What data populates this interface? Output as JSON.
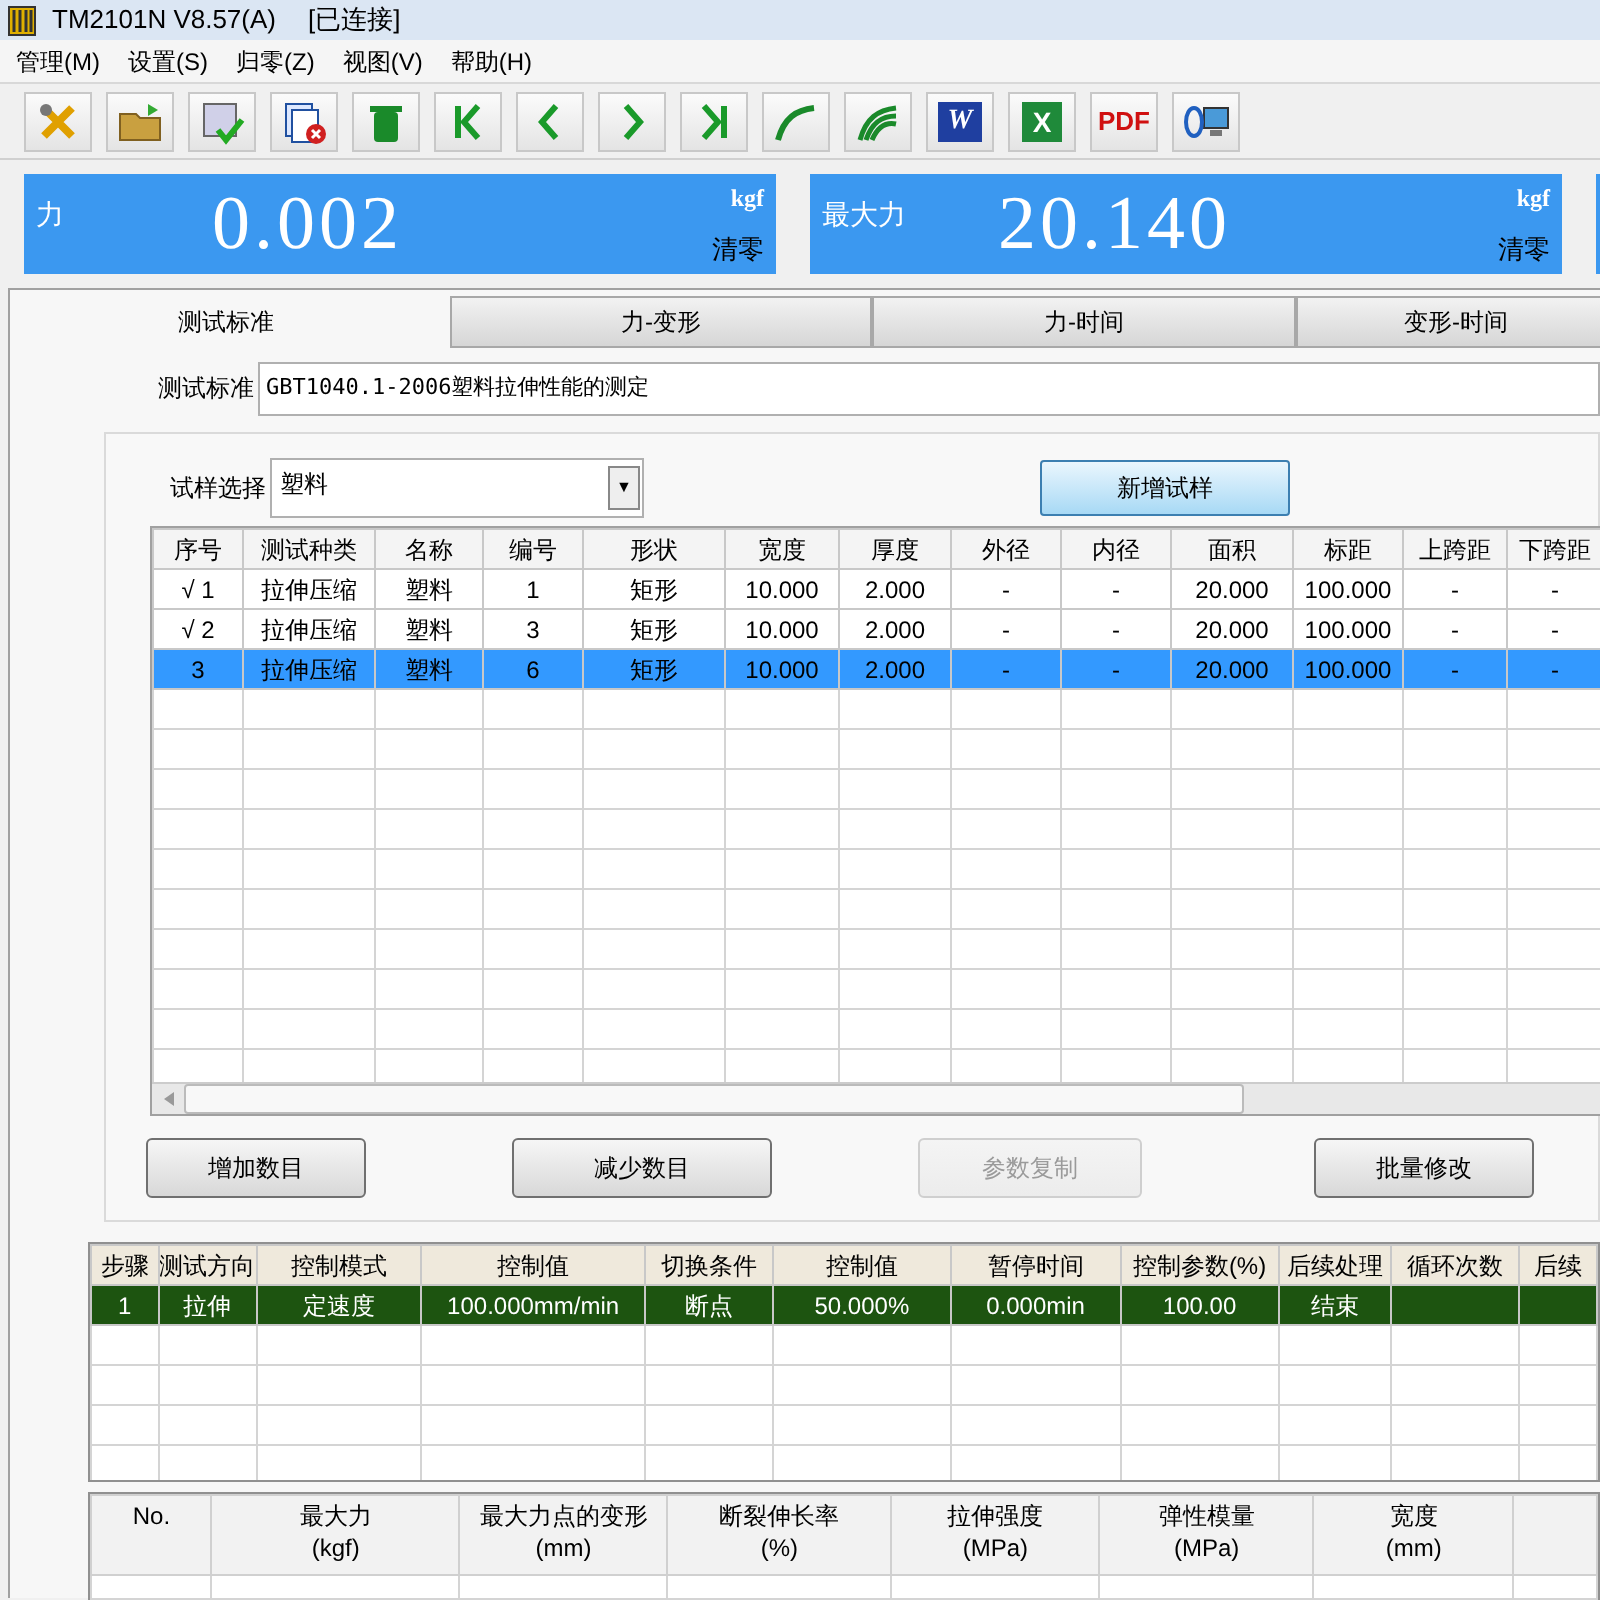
{
  "window": {
    "title": "TM2101N V8.57(A)",
    "status": "[已连接]"
  },
  "menu": [
    "管理(M)",
    "设置(S)",
    "归零(Z)",
    "视图(V)",
    "帮助(H)"
  ],
  "toolbar": [
    {
      "kind": "tools"
    },
    {
      "kind": "folder"
    },
    {
      "kind": "save"
    },
    {
      "kind": "delete-doc"
    },
    {
      "kind": "trash"
    },
    {
      "kind": "first"
    },
    {
      "kind": "prev"
    },
    {
      "kind": "next"
    },
    {
      "kind": "last"
    },
    {
      "kind": "curve"
    },
    {
      "kind": "curves"
    },
    {
      "kind": "word",
      "label": "W"
    },
    {
      "kind": "excel",
      "label": "X"
    },
    {
      "kind": "pdf",
      "label": "PDF"
    },
    {
      "kind": "connect"
    }
  ],
  "displays": [
    {
      "label": "力",
      "value": "0.002",
      "unit": "kgf",
      "zero_button": "清零"
    },
    {
      "label": "最大力",
      "value": "20.140",
      "unit": "kgf",
      "zero_button": "清零"
    }
  ],
  "tabs": [
    {
      "label": "测试标准",
      "selected": true
    },
    {
      "label": "力-变形",
      "selected": false
    },
    {
      "label": "力-时间",
      "selected": false
    },
    {
      "label": "变形-时间",
      "selected": false
    }
  ],
  "standard": {
    "label": "测试标准",
    "value": "GBT1040.1-2006塑料拉伸性能的测定"
  },
  "sample_select": {
    "label": "试样选择",
    "value": "塑料",
    "dropdown_icon": "▼"
  },
  "new_sample_button": "新增试样",
  "samples": {
    "columns": [
      "序号",
      "测试种类",
      "名称",
      "编号",
      "形状",
      "宽度",
      "厚度",
      "外径",
      "内径",
      "面积",
      "标距",
      "上跨距",
      "下跨距"
    ],
    "rows": [
      {
        "selected": false,
        "cells": [
          "√ 1",
          "拉伸压缩",
          "塑料",
          "1",
          "矩形",
          "10.000",
          "2.000",
          "-",
          "-",
          "20.000",
          "100.000",
          "-",
          "-"
        ]
      },
      {
        "selected": false,
        "cells": [
          "√ 2",
          "拉伸压缩",
          "塑料",
          "3",
          "矩形",
          "10.000",
          "2.000",
          "-",
          "-",
          "20.000",
          "100.000",
          "-",
          "-"
        ]
      },
      {
        "selected": true,
        "cells": [
          "3",
          "拉伸压缩",
          "塑料",
          "6",
          "矩形",
          "10.000",
          "2.000",
          "-",
          "-",
          "20.000",
          "100.000",
          "-",
          "-"
        ]
      }
    ]
  },
  "buttons": [
    {
      "label": "增加数目",
      "disabled": false
    },
    {
      "label": "减少数目",
      "disabled": false
    },
    {
      "label": "参数复制",
      "disabled": true
    },
    {
      "label": "批量修改",
      "disabled": false
    }
  ],
  "steps": {
    "columns": [
      "步骤",
      "测试方向",
      "控制模式",
      "控制值",
      "切换条件",
      "控制值",
      "暂停时间",
      "控制参数(%)",
      "后续处理",
      "循环次数",
      "后续"
    ],
    "rows": [
      {
        "selected": true,
        "cells": [
          "1",
          "拉伸",
          "定速度",
          "100.000mm/min",
          "断点",
          "50.000%",
          "0.000min",
          "100.00",
          "结束",
          "",
          ""
        ]
      }
    ]
  },
  "results": {
    "columns": [
      [
        "No.",
        ""
      ],
      [
        "最大力",
        "(kgf)"
      ],
      [
        "最大力点的变形",
        "(mm)"
      ],
      [
        "断裂伸长率",
        "(%)"
      ],
      [
        "拉伸强度",
        "(MPa)"
      ],
      [
        "弹性模量",
        "(MPa)"
      ],
      [
        "宽度",
        "(mm)"
      ],
      [
        "",
        ""
      ]
    ]
  }
}
